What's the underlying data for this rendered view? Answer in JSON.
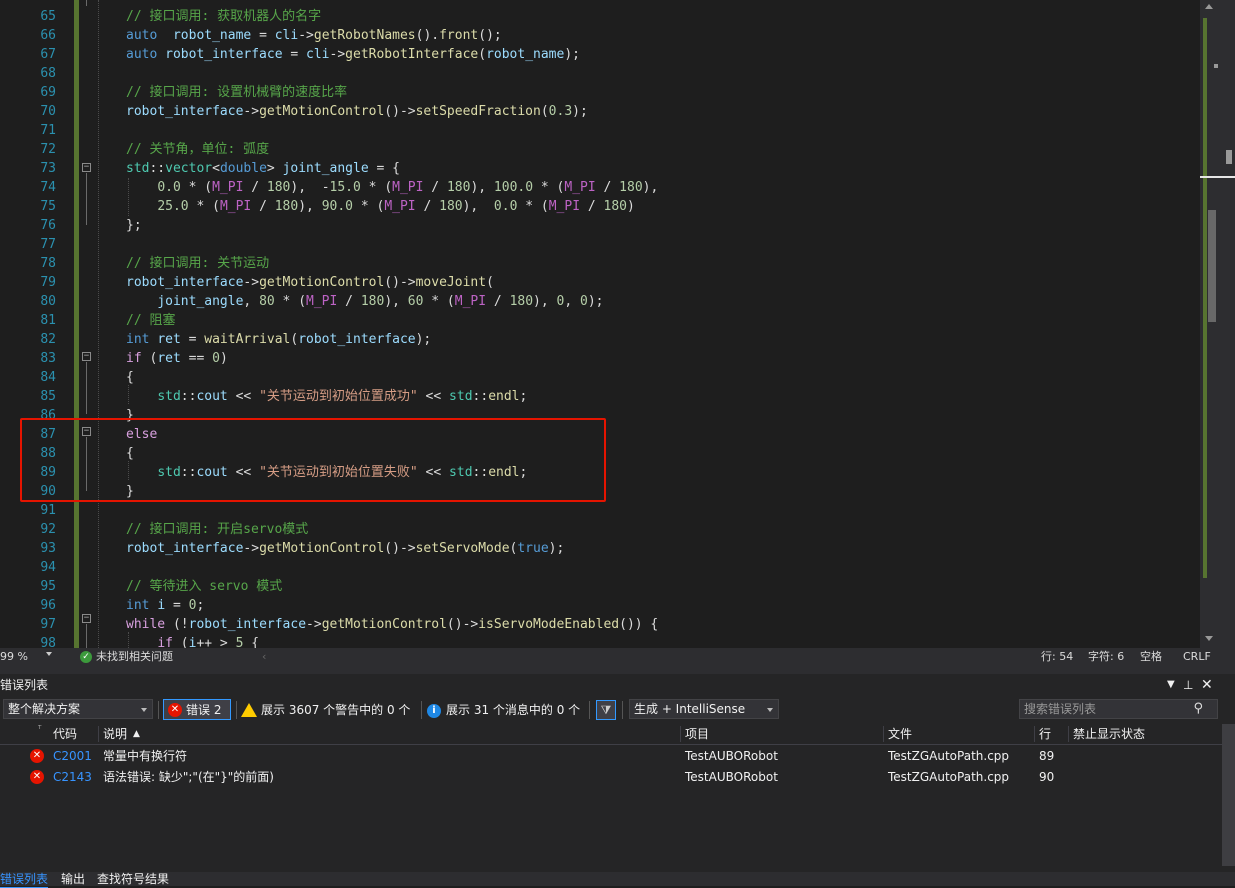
{
  "editor": {
    "lines": [
      {
        "num": "65",
        "segs": [
          [
            "c",
            "// 接口调用: 获取机器人的名字"
          ]
        ]
      },
      {
        "num": "66",
        "segs": [
          [
            "k",
            "auto"
          ],
          [
            "",
            "  "
          ],
          [
            "v",
            "robot_name"
          ],
          [
            "",
            " = "
          ],
          [
            "v",
            "cli"
          ],
          [
            "",
            "->"
          ],
          [
            "f",
            "getRobotNames"
          ],
          [
            "",
            "()."
          ],
          [
            "f",
            "front"
          ],
          [
            "",
            "();"
          ]
        ]
      },
      {
        "num": "67",
        "segs": [
          [
            "k",
            "auto"
          ],
          [
            "",
            " "
          ],
          [
            "v",
            "robot_interface"
          ],
          [
            "",
            " = "
          ],
          [
            "v",
            "cli"
          ],
          [
            "",
            "->"
          ],
          [
            "f",
            "getRobotInterface"
          ],
          [
            "",
            "("
          ],
          [
            "v",
            "robot_name"
          ],
          [
            "",
            ");"
          ]
        ]
      },
      {
        "num": "68",
        "segs": []
      },
      {
        "num": "69",
        "segs": [
          [
            "c",
            "// 接口调用: 设置机械臂的速度比率"
          ]
        ]
      },
      {
        "num": "70",
        "segs": [
          [
            "v",
            "robot_interface"
          ],
          [
            "",
            "->"
          ],
          [
            "f",
            "getMotionControl"
          ],
          [
            "",
            "()->"
          ],
          [
            "f",
            "setSpeedFraction"
          ],
          [
            "",
            "("
          ],
          [
            "n",
            "0.3"
          ],
          [
            "",
            ");"
          ]
        ]
      },
      {
        "num": "71",
        "segs": []
      },
      {
        "num": "72",
        "segs": [
          [
            "c",
            "// 关节角，单位: 弧度"
          ]
        ]
      },
      {
        "num": "73",
        "segs": [
          [
            "t",
            "std"
          ],
          [
            "",
            "::"
          ],
          [
            "t",
            "vector"
          ],
          [
            "",
            "<"
          ],
          [
            "k",
            "double"
          ],
          [
            "",
            "> "
          ],
          [
            "v",
            "joint_angle"
          ],
          [
            "",
            " = {"
          ]
        ]
      },
      {
        "num": "74",
        "segs": [
          [
            "",
            "    "
          ],
          [
            "n",
            "0.0"
          ],
          [
            "",
            " * ("
          ],
          [
            "m",
            "M_PI"
          ],
          [
            "",
            " / "
          ],
          [
            "n",
            "180"
          ],
          [
            "",
            "),  -"
          ],
          [
            "n",
            "15.0"
          ],
          [
            "",
            " * ("
          ],
          [
            "m",
            "M_PI"
          ],
          [
            "",
            " / "
          ],
          [
            "n",
            "180"
          ],
          [
            "",
            "), "
          ],
          [
            "n",
            "100.0"
          ],
          [
            "",
            " * ("
          ],
          [
            "m",
            "M_PI"
          ],
          [
            "",
            " / "
          ],
          [
            "n",
            "180"
          ],
          [
            "",
            "),"
          ]
        ]
      },
      {
        "num": "75",
        "segs": [
          [
            "",
            "    "
          ],
          [
            "n",
            "25.0"
          ],
          [
            "",
            " * ("
          ],
          [
            "m",
            "M_PI"
          ],
          [
            "",
            " / "
          ],
          [
            "n",
            "180"
          ],
          [
            "",
            "), "
          ],
          [
            "n",
            "90.0"
          ],
          [
            "",
            " * ("
          ],
          [
            "m",
            "M_PI"
          ],
          [
            "",
            " / "
          ],
          [
            "n",
            "180"
          ],
          [
            "",
            "),  "
          ],
          [
            "n",
            "0.0"
          ],
          [
            "",
            " * ("
          ],
          [
            "m",
            "M_PI"
          ],
          [
            "",
            " / "
          ],
          [
            "n",
            "180"
          ],
          [
            "",
            ")"
          ]
        ]
      },
      {
        "num": "76",
        "segs": [
          [
            "",
            "};"
          ]
        ]
      },
      {
        "num": "77",
        "segs": []
      },
      {
        "num": "78",
        "segs": [
          [
            "c",
            "// 接口调用: 关节运动"
          ]
        ]
      },
      {
        "num": "79",
        "segs": [
          [
            "v",
            "robot_interface"
          ],
          [
            "",
            "->"
          ],
          [
            "f",
            "getMotionControl"
          ],
          [
            "",
            "()->"
          ],
          [
            "f",
            "moveJoint"
          ],
          [
            "",
            "("
          ]
        ]
      },
      {
        "num": "80",
        "segs": [
          [
            "",
            "    "
          ],
          [
            "v",
            "joint_angle"
          ],
          [
            "",
            ", "
          ],
          [
            "n",
            "80"
          ],
          [
            "",
            " * ("
          ],
          [
            "m",
            "M_PI"
          ],
          [
            "",
            " / "
          ],
          [
            "n",
            "180"
          ],
          [
            "",
            "), "
          ],
          [
            "n",
            "60"
          ],
          [
            "",
            " * ("
          ],
          [
            "m",
            "M_PI"
          ],
          [
            "",
            " / "
          ],
          [
            "n",
            "180"
          ],
          [
            "",
            "), "
          ],
          [
            "n",
            "0"
          ],
          [
            "",
            ", "
          ],
          [
            "n",
            "0"
          ],
          [
            "",
            ");"
          ]
        ]
      },
      {
        "num": "81",
        "segs": [
          [
            "c",
            "// 阻塞"
          ]
        ]
      },
      {
        "num": "82",
        "segs": [
          [
            "k",
            "int"
          ],
          [
            "",
            " "
          ],
          [
            "v",
            "ret"
          ],
          [
            "",
            " = "
          ],
          [
            "f",
            "waitArrival"
          ],
          [
            "",
            "("
          ],
          [
            "v",
            "robot_interface"
          ],
          [
            "",
            ");"
          ]
        ]
      },
      {
        "num": "83",
        "segs": [
          [
            "kc",
            "if"
          ],
          [
            "",
            " ("
          ],
          [
            "v",
            "ret"
          ],
          [
            "",
            " == "
          ],
          [
            "n",
            "0"
          ],
          [
            "",
            ")"
          ]
        ]
      },
      {
        "num": "84",
        "segs": [
          [
            "",
            "{"
          ]
        ]
      },
      {
        "num": "85",
        "segs": [
          [
            "",
            "    "
          ],
          [
            "t",
            "std"
          ],
          [
            "",
            "::"
          ],
          [
            "v",
            "cout"
          ],
          [
            "",
            " << "
          ],
          [
            "s",
            "\"关节运动到初始位置成功\""
          ],
          [
            "",
            " << "
          ],
          [
            "t",
            "std"
          ],
          [
            "",
            "::"
          ],
          [
            "f",
            "endl"
          ],
          [
            "",
            ";"
          ]
        ]
      },
      {
        "num": "86",
        "segs": [
          [
            "",
            "}"
          ]
        ]
      },
      {
        "num": "87",
        "segs": [
          [
            "kc",
            "else"
          ]
        ]
      },
      {
        "num": "88",
        "segs": [
          [
            "",
            "{"
          ]
        ]
      },
      {
        "num": "89",
        "segs": [
          [
            "",
            "    "
          ],
          [
            "t",
            "std"
          ],
          [
            "",
            "::"
          ],
          [
            "v",
            "cout"
          ],
          [
            "",
            " << "
          ],
          [
            "s",
            "\"关节运动到初始位置失败\""
          ],
          [
            "",
            " << "
          ],
          [
            "t",
            "std"
          ],
          [
            "",
            "::"
          ],
          [
            "f",
            "endl"
          ],
          [
            "",
            ";"
          ]
        ]
      },
      {
        "num": "90",
        "segs": [
          [
            "",
            "}"
          ]
        ]
      },
      {
        "num": "91",
        "segs": []
      },
      {
        "num": "92",
        "segs": [
          [
            "c",
            "// 接口调用: 开启servo模式"
          ]
        ]
      },
      {
        "num": "93",
        "segs": [
          [
            "v",
            "robot_interface"
          ],
          [
            "",
            "->"
          ],
          [
            "f",
            "getMotionControl"
          ],
          [
            "",
            "()->"
          ],
          [
            "f",
            "setServoMode"
          ],
          [
            "",
            "("
          ],
          [
            "k",
            "true"
          ],
          [
            "",
            ");"
          ]
        ]
      },
      {
        "num": "94",
        "segs": []
      },
      {
        "num": "95",
        "segs": [
          [
            "c",
            "// 等待进入 servo 模式"
          ]
        ]
      },
      {
        "num": "96",
        "segs": [
          [
            "k",
            "int"
          ],
          [
            "",
            " "
          ],
          [
            "v",
            "i"
          ],
          [
            "",
            " = "
          ],
          [
            "n",
            "0"
          ],
          [
            "",
            ";"
          ]
        ]
      },
      {
        "num": "97",
        "segs": [
          [
            "kc",
            "while"
          ],
          [
            "",
            " (!"
          ],
          [
            "v",
            "robot_interface"
          ],
          [
            "",
            "->"
          ],
          [
            "f",
            "getMotionControl"
          ],
          [
            "",
            "()->"
          ],
          [
            "f",
            "isServoModeEnabled"
          ],
          [
            "",
            "()) {"
          ]
        ]
      },
      {
        "num": "98",
        "segs": [
          [
            "",
            "    "
          ],
          [
            "kc",
            "if"
          ],
          [
            "",
            " ("
          ],
          [
            "v",
            "i"
          ],
          [
            "",
            "++ > "
          ],
          [
            "n",
            "5"
          ],
          [
            "",
            " {"
          ]
        ]
      }
    ]
  },
  "status": {
    "zoom": "99 %",
    "issues": "未找到相关问题",
    "line": "行: 54",
    "char": "字符: 6",
    "whitespace": "空格",
    "eol": "CRLF"
  },
  "panel": {
    "title": "错误列表",
    "scope": "整个解决方案",
    "errors_filter": "错误 2",
    "warnings_filter": "展示 3607 个警告中的 0 个",
    "messages_filter": "展示 31 个消息中的 0 个",
    "build_filter": "生成 + IntelliSense",
    "search_placeholder": "搜索错误列表",
    "columns": {
      "code": "代码",
      "desc": "说明",
      "project": "项目",
      "file": "文件",
      "line": "行",
      "suppress": "禁止显示状态"
    },
    "rows": [
      {
        "code": "C2001",
        "desc": "常量中有换行符",
        "project": "TestAUBORobot",
        "file": "TestZGAutoPath.cpp",
        "line": "89"
      },
      {
        "code": "C2143",
        "desc": "语法错误: 缺少\";\"(在\"}\"的前面)",
        "project": "TestAUBORobot",
        "file": "TestZGAutoPath.cpp",
        "line": "90"
      }
    ]
  },
  "bottom_tabs": [
    "错误列表",
    "输出",
    "查找符号结果"
  ],
  "colors": {
    "accent": "#3399ff",
    "error": "#e51400",
    "highlight_box": "#e51400"
  }
}
